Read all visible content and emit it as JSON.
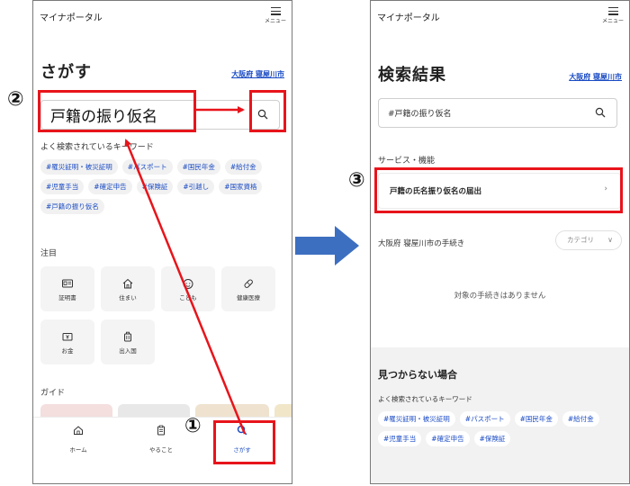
{
  "left_screen": {
    "app_name": "マイナポータル",
    "menu_label": "メニュー",
    "page_title": "さがす",
    "city_link": "大阪府 寝屋川市",
    "search_value": "戸籍の振り仮名",
    "keywords_label": "よく検索されているキーワード",
    "keywords": [
      "#罹災証明・被災証明",
      "#パスポート",
      "#国民年金",
      "#給付金",
      "#児童手当",
      "#確定申告",
      "#保険証",
      "#引越し",
      "#国家資格",
      "#戸籍の振り仮名"
    ],
    "attention_label": "注目",
    "categories": [
      {
        "label": "証明書",
        "icon": "id-card-icon"
      },
      {
        "label": "住まい",
        "icon": "house-icon"
      },
      {
        "label": "こども",
        "icon": "child-face-icon"
      },
      {
        "label": "健康医療",
        "icon": "capsule-icon"
      },
      {
        "label": "お金",
        "icon": "money-icon"
      },
      {
        "label": "出入国",
        "icon": "luggage-icon"
      }
    ],
    "guide_label": "ガイド",
    "bottom_nav": [
      {
        "label": "ホーム",
        "icon": "home-icon"
      },
      {
        "label": "やること",
        "icon": "clipboard-icon"
      },
      {
        "label": "さがす",
        "icon": "search-icon"
      }
    ]
  },
  "right_screen": {
    "app_name": "マイナポータル",
    "menu_label": "メニュー",
    "page_title": "検索結果",
    "city_link": "大阪府 寝屋川市",
    "search_value": "#戸籍の振り仮名",
    "services_label": "サービス・機能",
    "service_item": "戸籍の氏名振り仮名の届出",
    "service_chevron": "›",
    "procedures_title": "大阪府 寝屋川市の手続き",
    "category_dropdown": "カテゴリ",
    "category_chevron": "∨",
    "empty_message": "対象の手続きはありません",
    "not_found_title": "見つからない場合",
    "not_found_keywords_label": "よく検索されているキーワード",
    "not_found_keywords": [
      "#罹災証明・被災証明",
      "#パスポート",
      "#国民年金",
      "#給付金",
      "#児童手当",
      "#確定申告",
      "#保険証"
    ]
  },
  "annotations": {
    "step1": "①",
    "step2": "②",
    "step3": "③",
    "highlight_color": "#e8141b",
    "flow_arrow_color": "#3d6fc1"
  },
  "colors": {
    "accent_blue": "#1a4bc4",
    "tag_bg": "#f1f1f1"
  }
}
